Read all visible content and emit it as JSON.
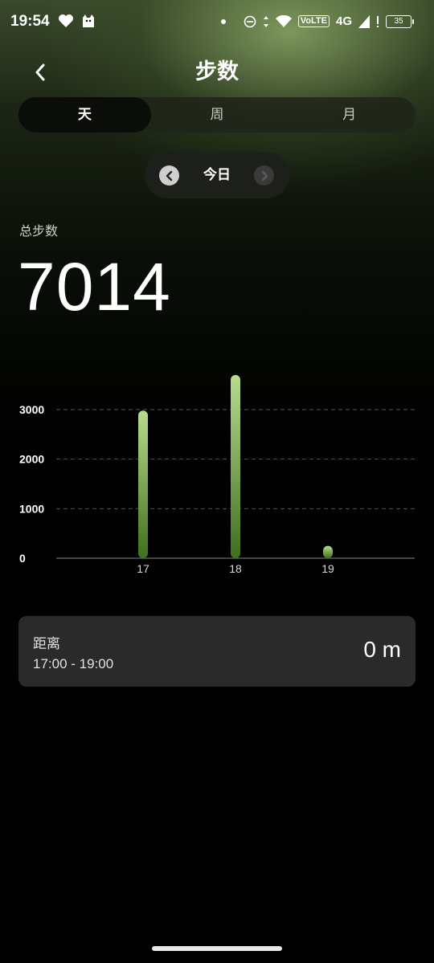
{
  "status_bar": {
    "time": "19:54",
    "volte": "VoLTE",
    "network": "4G",
    "battery": "35"
  },
  "header": {
    "title": "步数"
  },
  "tabs": [
    {
      "label": "天",
      "active": true
    },
    {
      "label": "周",
      "active": false
    },
    {
      "label": "月",
      "active": false
    }
  ],
  "date_nav": {
    "label": "今日"
  },
  "summary": {
    "label": "总步数",
    "value": "7014"
  },
  "chart_data": {
    "type": "bar",
    "categories": [
      "17",
      "18",
      "19"
    ],
    "values": [
      2980,
      3700,
      250
    ],
    "ylim": [
      0,
      3000
    ],
    "yticks": [
      "0",
      "1000",
      "2000",
      "3000"
    ],
    "grid": true,
    "colors": {
      "top": "#b9dc8f",
      "bottom": "#3f6f1f"
    }
  },
  "distance": {
    "label": "距离",
    "range": "17:00 - 19:00",
    "value": "0 m"
  }
}
